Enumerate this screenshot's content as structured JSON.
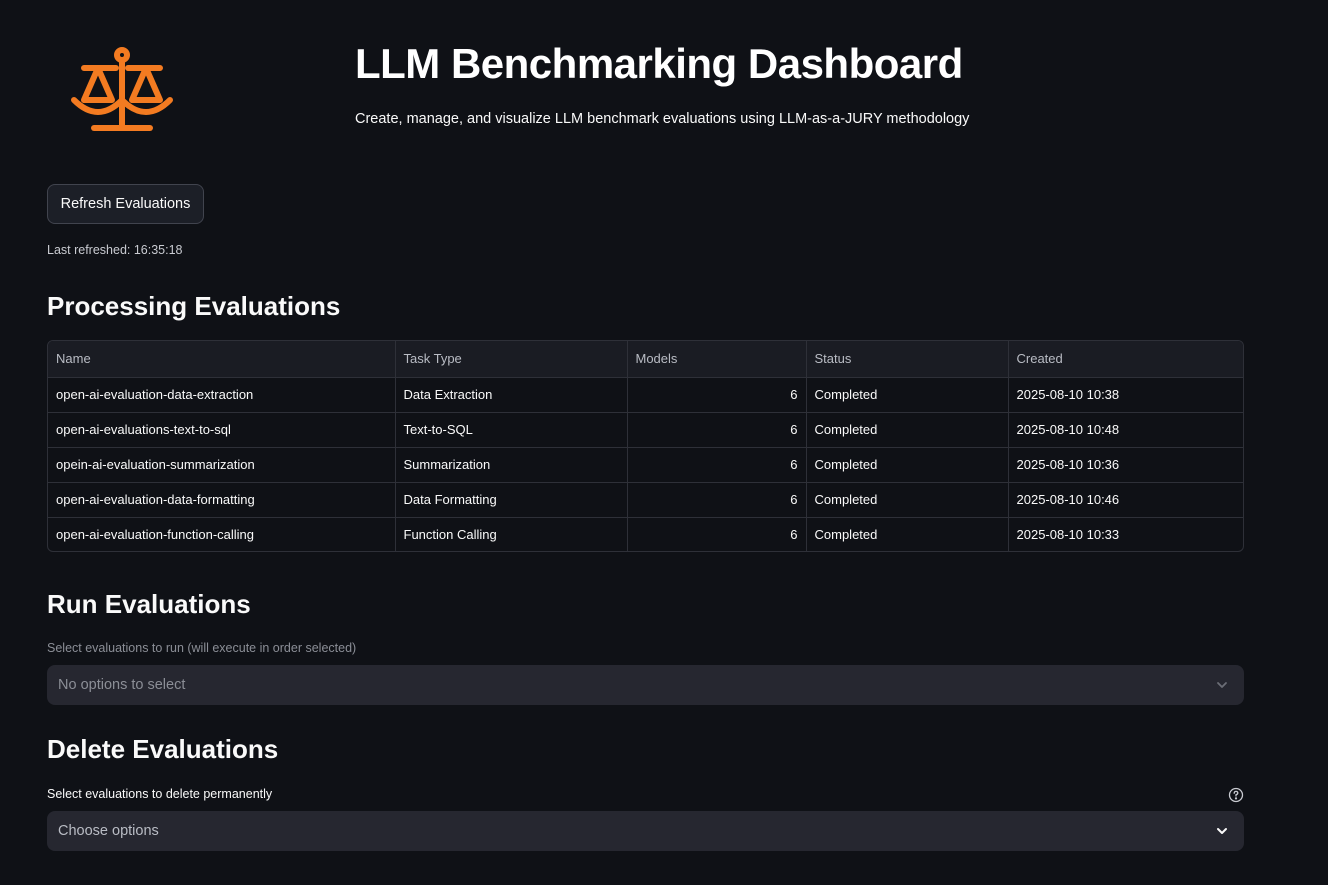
{
  "header": {
    "logo_icon": "balance-scale-icon",
    "title": "LLM Benchmarking Dashboard",
    "subtitle": "Create, manage, and visualize LLM benchmark evaluations using LLM-as-a-JURY methodology"
  },
  "refresh": {
    "button_label": "Refresh Evaluations",
    "last_refreshed": "Last refreshed: 16:35:18"
  },
  "processing": {
    "heading": "Processing Evaluations",
    "columns": [
      "Name",
      "Task Type",
      "Models",
      "Status",
      "Created"
    ],
    "rows": [
      [
        "open-ai-evaluation-data-extraction",
        "Data Extraction",
        "6",
        "Completed",
        "2025-08-10 10:38"
      ],
      [
        "open-ai-evaluations-text-to-sql",
        "Text-to-SQL",
        "6",
        "Completed",
        "2025-08-10 10:48"
      ],
      [
        "opein-ai-evaluation-summarization",
        "Summarization",
        "6",
        "Completed",
        "2025-08-10 10:36"
      ],
      [
        "open-ai-evaluation-data-formatting",
        "Data Formatting",
        "6",
        "Completed",
        "2025-08-10 10:46"
      ],
      [
        "open-ai-evaluation-function-calling",
        "Function Calling",
        "6",
        "Completed",
        "2025-08-10 10:33"
      ]
    ]
  },
  "run": {
    "heading": "Run Evaluations",
    "label": "Select evaluations to run (will execute in order selected)",
    "placeholder": "No options to select"
  },
  "delete": {
    "heading": "Delete Evaluations",
    "label": "Select evaluations to delete permanently",
    "placeholder": "Choose options"
  },
  "colors": {
    "accent": "#f37b21",
    "background": "#0f1116",
    "input_bg": "#262730"
  }
}
